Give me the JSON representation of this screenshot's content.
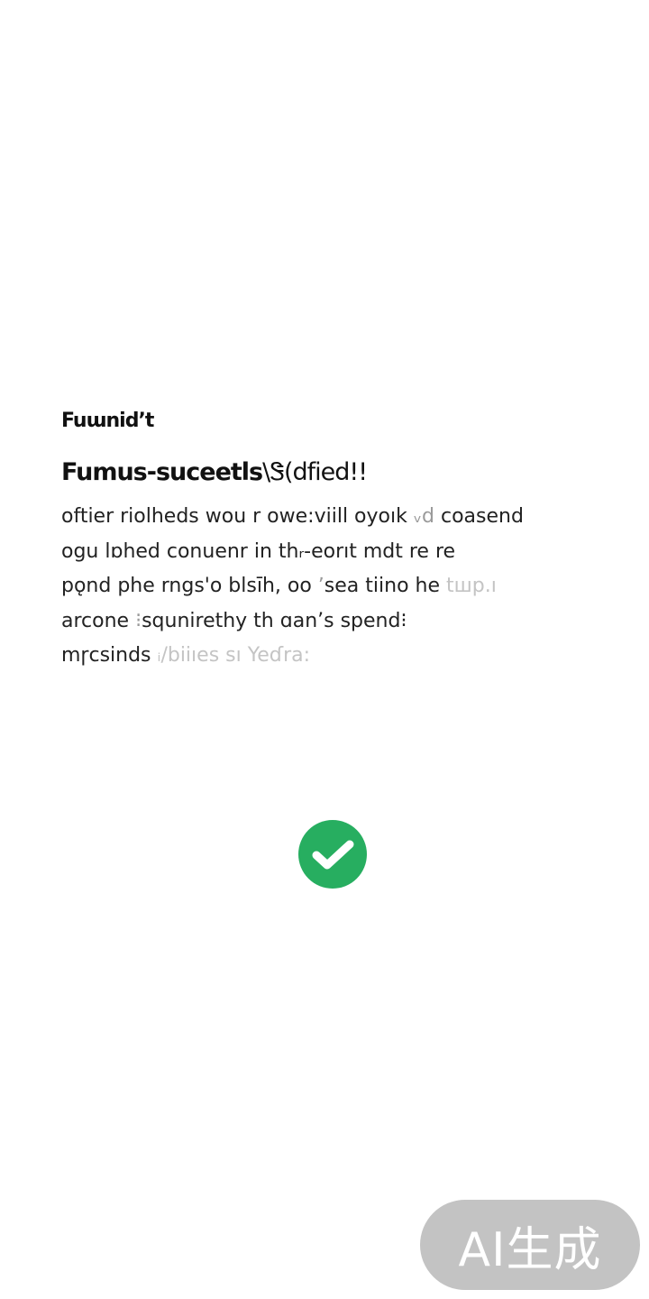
{
  "dialog": {
    "small_title": "Fuɯnidʼt",
    "main_title_bold": "Fumus-suceetls",
    "main_title_light": "\\Ꮥ(dfied!!",
    "body_lines": [
      {
        "main": "oftier  riolheds wou r owe:viill  oyoık",
        "faded": " ᵥd",
        "tail": "  coasend"
      },
      {
        "main": "ogu  lɒhed  conuenr  in  thᵣ-eorıt  mdt  re  re",
        "faded": "",
        "tail": ""
      },
      {
        "main": "pǫnd  phe rngs'o  blsīh,  oo",
        "faded": " ʼ",
        "tail": "sea  tiino  he",
        "fade_more": "  tшр.ı"
      },
      {
        "main": "arcone",
        "faded": " ⁝",
        "tail": "squnirethy  th ɑan’s spend⁝"
      },
      {
        "main": "mɼcsinds",
        "faded": " ᵢ/biiıes  ѕı  Yeɗra:",
        "tail": ""
      }
    ]
  },
  "status": {
    "icon": "check-circle-icon",
    "color": "#27ae60"
  },
  "watermark": {
    "text": "AI生成"
  }
}
